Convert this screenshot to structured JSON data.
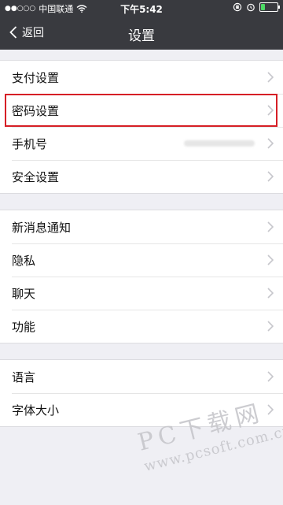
{
  "status_bar": {
    "signal": "●●○○○",
    "carrier": "中国联通",
    "wifi_icon": "wifi-icon",
    "time": "下午5:42",
    "battery_level": 0.25,
    "icons": [
      "orientation-lock-icon",
      "alarm-icon",
      "battery-icon"
    ]
  },
  "nav": {
    "back_label": "返回",
    "title": "设置"
  },
  "groups": [
    {
      "items": [
        {
          "label": "支付设置"
        },
        {
          "label": "密码设置",
          "highlighted": true
        },
        {
          "label": "手机号",
          "value_blurred": true
        },
        {
          "label": "安全设置"
        }
      ]
    },
    {
      "items": [
        {
          "label": "新消息通知"
        },
        {
          "label": "隐私"
        },
        {
          "label": "聊天"
        },
        {
          "label": "功能"
        }
      ]
    },
    {
      "items": [
        {
          "label": "语言"
        },
        {
          "label": "字体大小"
        }
      ]
    }
  ],
  "watermark": {
    "line1": "PC下载网",
    "line2": "www.pcsoft.com.cn"
  },
  "colors": {
    "nav_bg": "#393a3f",
    "page_bg": "#efeff4",
    "highlight_border": "#d61f26",
    "battery_fill": "#4cd964"
  }
}
